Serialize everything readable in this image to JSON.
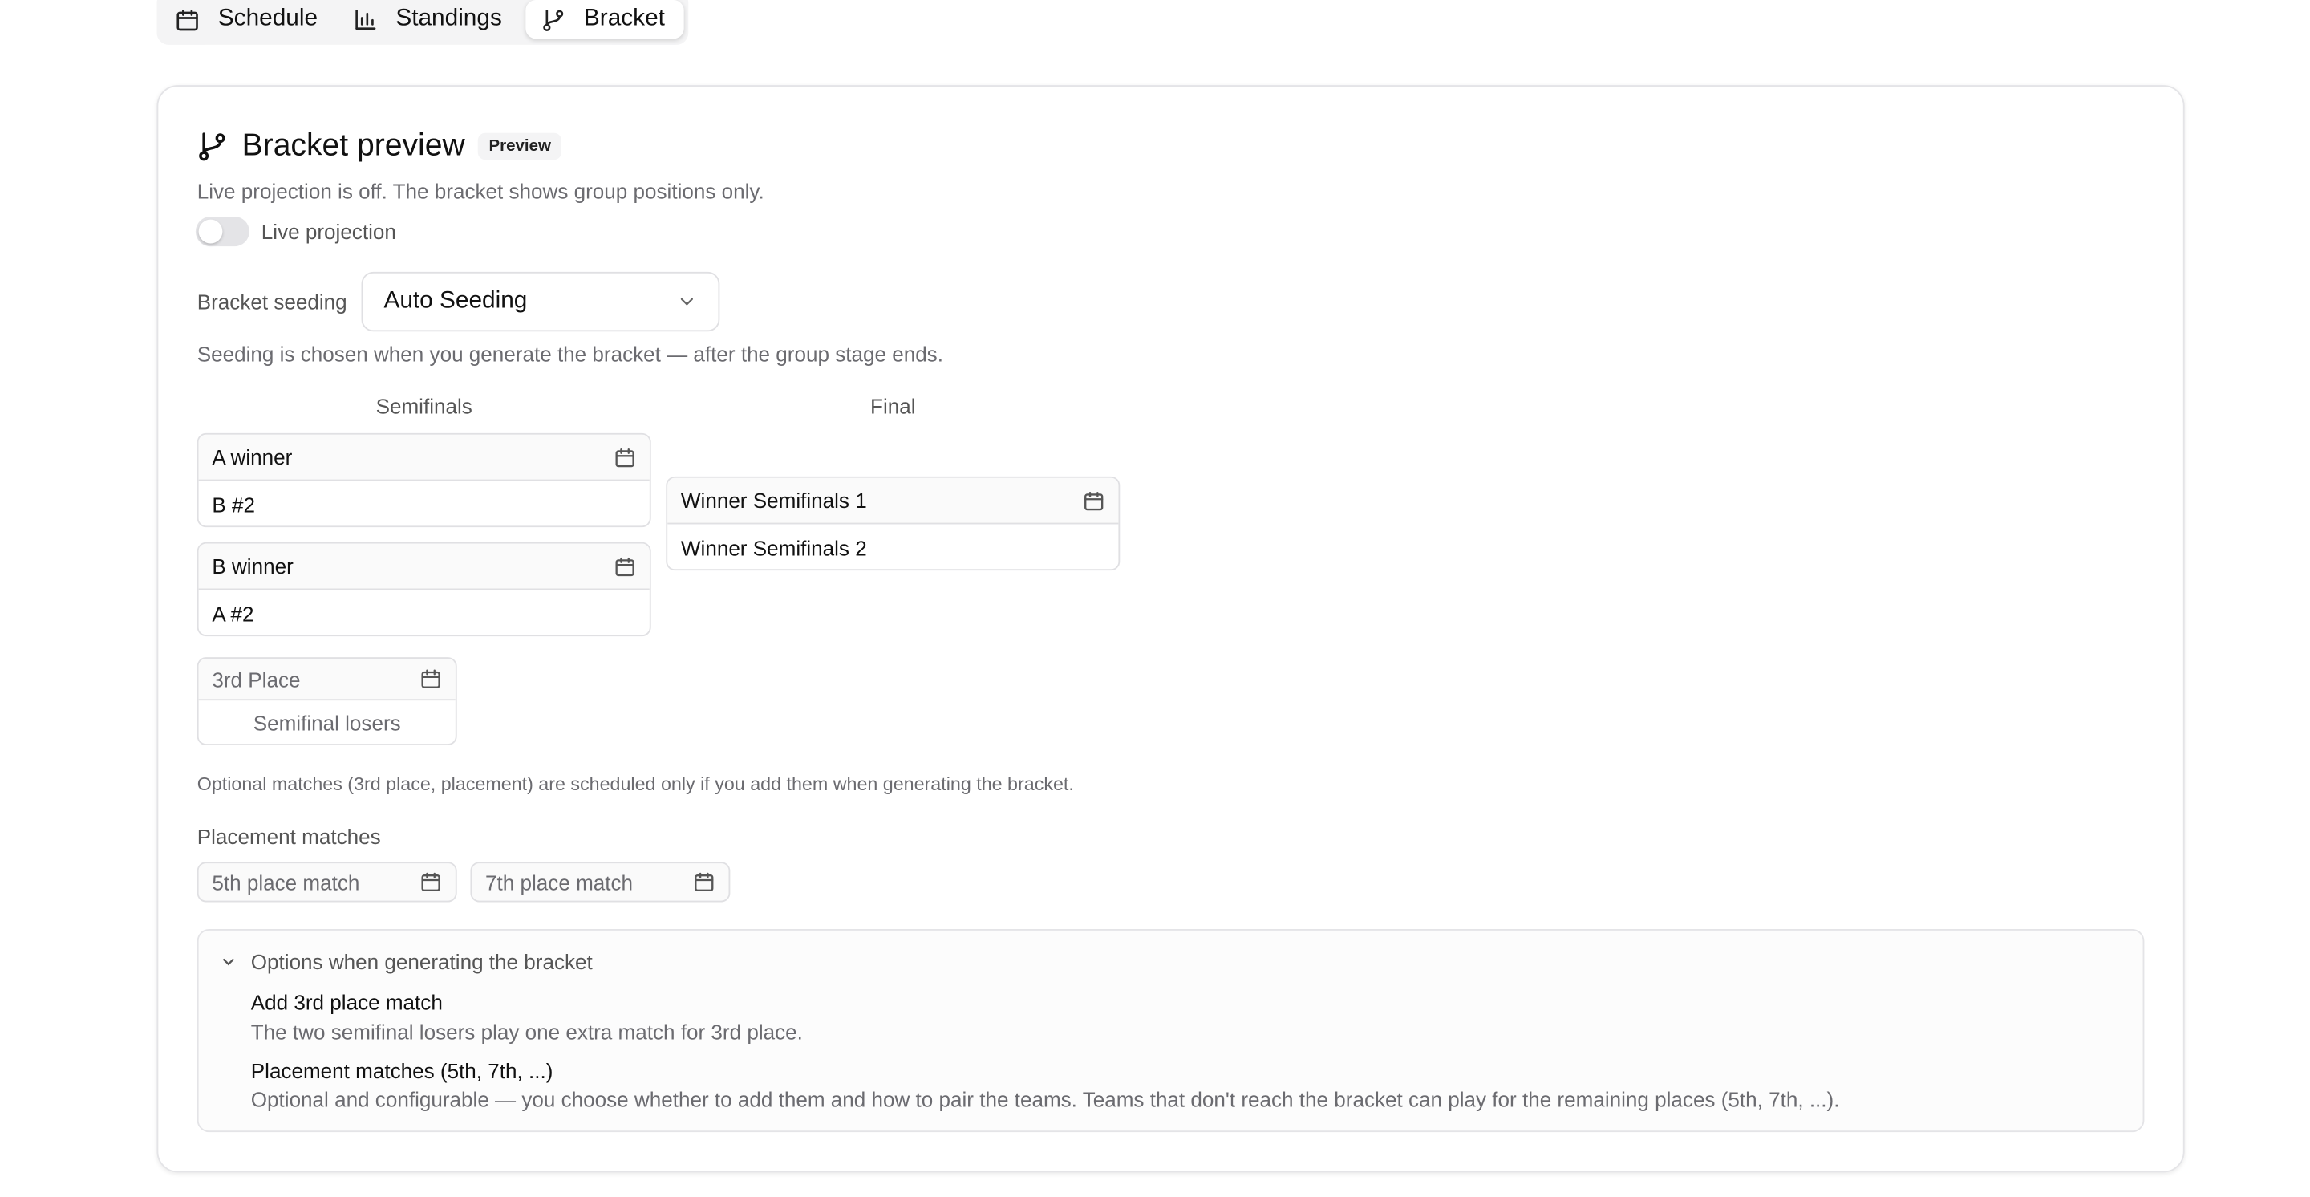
{
  "tabs": [
    {
      "label": "Schedule",
      "icon": "calendar-icon"
    },
    {
      "label": "Standings",
      "icon": "bar-chart-icon"
    },
    {
      "label": "Bracket",
      "icon": "git-branch-icon",
      "active": true
    }
  ],
  "header": {
    "title": "Bracket preview",
    "badge": "Preview",
    "description": "Live projection is off. The bracket shows group positions only.",
    "toggle_label": "Live projection",
    "toggle_on": false
  },
  "seeding": {
    "label": "Bracket seeding",
    "selected": "Auto Seeding",
    "note": "Seeding is chosen when you generate the bracket — after the group stage ends."
  },
  "bracket": {
    "semifinals_heading": "Semifinals",
    "final_heading": "Final",
    "semifinals": [
      {
        "team1": "A winner",
        "team2": "B #2"
      },
      {
        "team1": "B winner",
        "team2": "A #2"
      }
    ],
    "final": {
      "team1": "Winner Semifinals 1",
      "team2": "Winner Semifinals 2"
    },
    "third_place": {
      "title": "3rd Place",
      "subtitle": "Semifinal losers"
    }
  },
  "optional_note": "Optional matches (3rd place, placement) are scheduled only if you add them when generating the bracket.",
  "placement": {
    "label": "Placement matches",
    "matches": [
      "5th place match",
      "7th place match"
    ]
  },
  "options": {
    "heading": "Options when generating the bracket",
    "items": [
      {
        "title": "Add 3rd place match",
        "desc": "The two semifinal losers play one extra match for 3rd place."
      },
      {
        "title": "Placement matches (5th, 7th, ...)",
        "desc": "Optional and configurable — you choose whether to add them and how to pair the teams. Teams that don't reach the bracket can play for the remaining places (5th, 7th, ...)."
      }
    ]
  }
}
